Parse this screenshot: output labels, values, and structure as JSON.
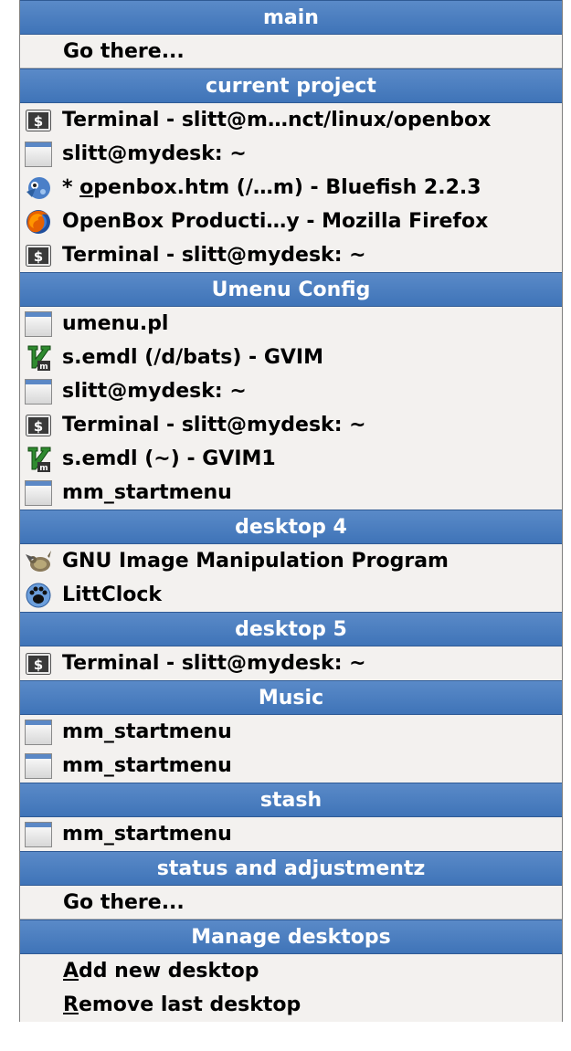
{
  "menu": {
    "sections": [
      {
        "title": "main",
        "items": [
          {
            "label": "Go there...",
            "icon": "none"
          }
        ]
      },
      {
        "title": "current project",
        "items": [
          {
            "label": "Terminal - slitt@m…nct/linux/openbox",
            "icon": "terminal-icon"
          },
          {
            "label": "slitt@mydesk: ~",
            "icon": "window-icon"
          },
          {
            "label": "* openbox.htm (/…m) - Bluefish 2.2.3",
            "icon": "bluefish-icon",
            "underline_char": "o"
          },
          {
            "label": "OpenBox Producti…y - Mozilla Firefox",
            "icon": "firefox-icon"
          },
          {
            "label": "Terminal - slitt@mydesk: ~",
            "icon": "terminal-icon"
          }
        ]
      },
      {
        "title": "Umenu Config",
        "items": [
          {
            "label": "umenu.pl",
            "icon": "window-icon"
          },
          {
            "label": "s.emdl (/d/bats) - GVIM",
            "icon": "gvim-icon"
          },
          {
            "label": "slitt@mydesk: ~",
            "icon": "window-icon"
          },
          {
            "label": "Terminal - slitt@mydesk: ~",
            "icon": "terminal-icon"
          },
          {
            "label": "s.emdl (~) - GVIM1",
            "icon": "gvim-icon"
          },
          {
            "label": "mm_startmenu",
            "icon": "window-icon"
          }
        ]
      },
      {
        "title": "desktop 4",
        "items": [
          {
            "label": "GNU Image Manipulation Program",
            "icon": "gimp-icon"
          },
          {
            "label": "LittClock",
            "icon": "paw-icon"
          }
        ]
      },
      {
        "title": "desktop 5",
        "items": [
          {
            "label": "Terminal - slitt@mydesk: ~",
            "icon": "terminal-icon"
          }
        ]
      },
      {
        "title": "Music",
        "items": [
          {
            "label": "mm_startmenu",
            "icon": "window-icon"
          },
          {
            "label": "mm_startmenu",
            "icon": "window-icon"
          }
        ]
      },
      {
        "title": "stash",
        "items": [
          {
            "label": "mm_startmenu",
            "icon": "window-icon"
          }
        ]
      },
      {
        "title": "status and adjustmentz",
        "items": [
          {
            "label": "Go there...",
            "icon": "none"
          }
        ]
      },
      {
        "title": "Manage desktops",
        "items": [
          {
            "label": "Add new desktop",
            "icon": "none",
            "underline_char": "A"
          },
          {
            "label": "Remove last desktop",
            "icon": "none",
            "underline_char": "R"
          }
        ]
      }
    ]
  }
}
